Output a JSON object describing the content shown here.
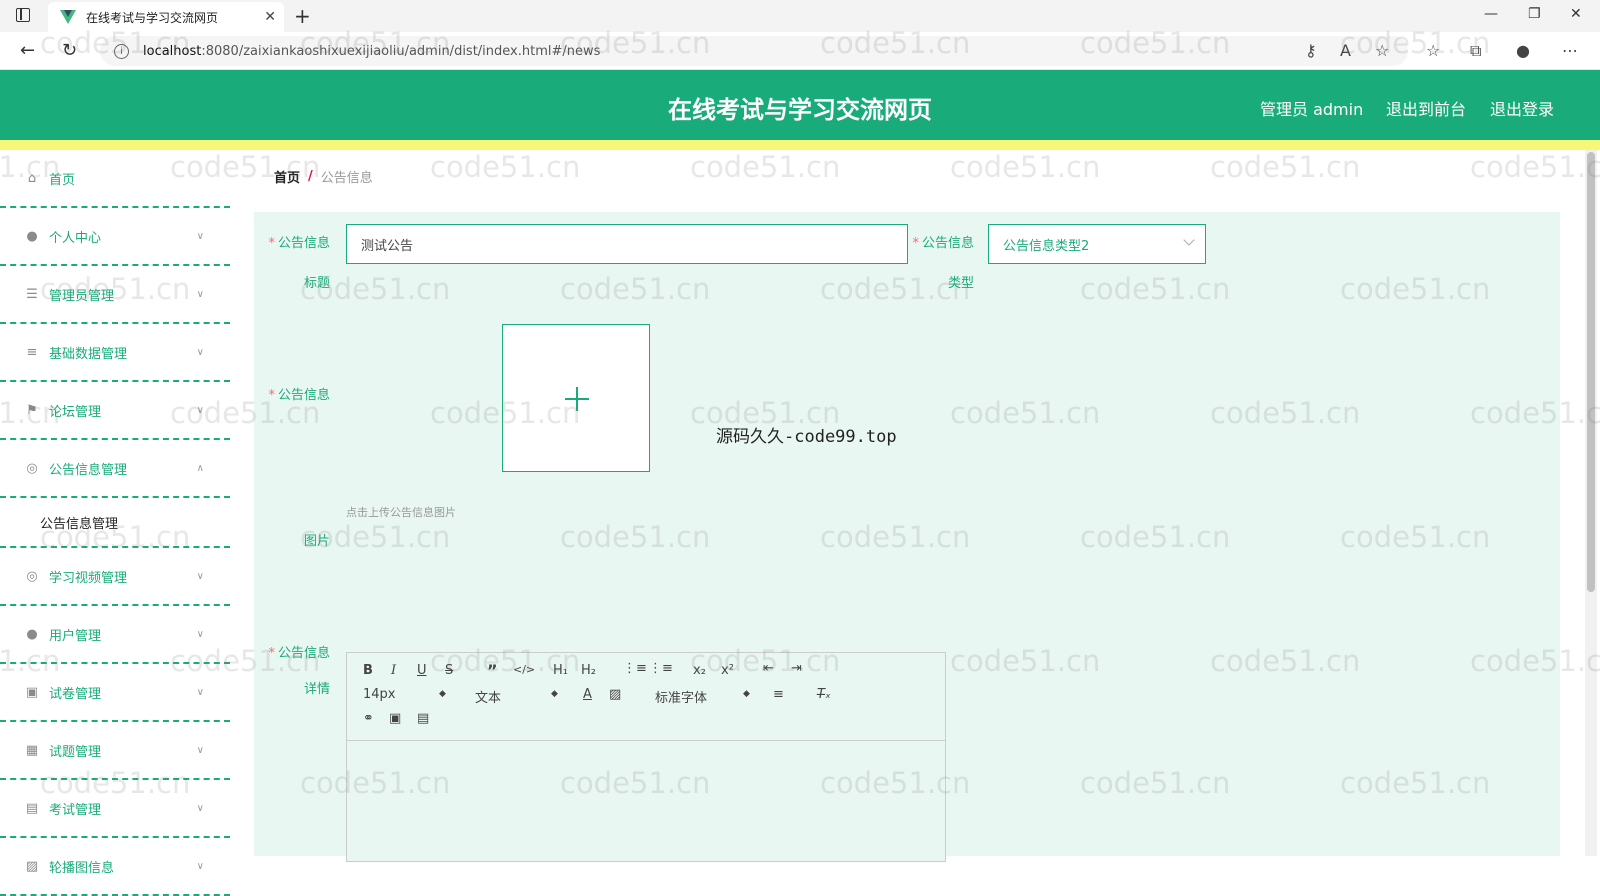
{
  "browser": {
    "tab_title": "在线考试与学习交流网页",
    "address_host": "localhost",
    "address_rest": ":8080/zaixiankaoshixuexijiaoliu/admin/dist/index.html#/news"
  },
  "header": {
    "title": "在线考试与学习交流网页",
    "user_label": "管理员 admin",
    "front_link": "退出到前台",
    "logout_link": "退出登录"
  },
  "sidebar": {
    "items": [
      {
        "label": "首页",
        "icon": "home-icon"
      },
      {
        "label": "个人中心",
        "icon": "user-icon"
      },
      {
        "label": "管理员管理",
        "icon": "list-icon"
      },
      {
        "label": "基础数据管理",
        "icon": "sliders-icon"
      },
      {
        "label": "论坛管理",
        "icon": "flag-icon"
      },
      {
        "label": "公告信息管理",
        "icon": "compass-icon"
      },
      {
        "label": "学习视频管理",
        "icon": "compass-icon"
      },
      {
        "label": "用户管理",
        "icon": "user-icon"
      },
      {
        "label": "试卷管理",
        "icon": "paper-icon"
      },
      {
        "label": "试题管理",
        "icon": "grid-icon"
      },
      {
        "label": "考试管理",
        "icon": "exam-icon"
      },
      {
        "label": "轮播图信息",
        "icon": "image-icon"
      }
    ],
    "sub_item": "公告信息管理"
  },
  "breadcrumb": {
    "home": "首页",
    "sep": "/",
    "current": "公告信息"
  },
  "form": {
    "title_label_1": "公告信息",
    "title_label_2": "标题",
    "title_value": "测试公告",
    "type_label_1": "公告信息",
    "type_label_2": "类型",
    "type_value": "公告信息类型2",
    "image_label_1": "公告信息",
    "image_label_2": "图片",
    "upload_hint": "点击上传公告信息图片",
    "detail_label_1": "公告信息",
    "detail_label_2": "详情",
    "req": "*"
  },
  "editor": {
    "font_size": "14px",
    "heading": "文本",
    "font_family": "标准字体"
  },
  "overlay_text": "源码久久-code99.top",
  "watermark": "code51.cn"
}
